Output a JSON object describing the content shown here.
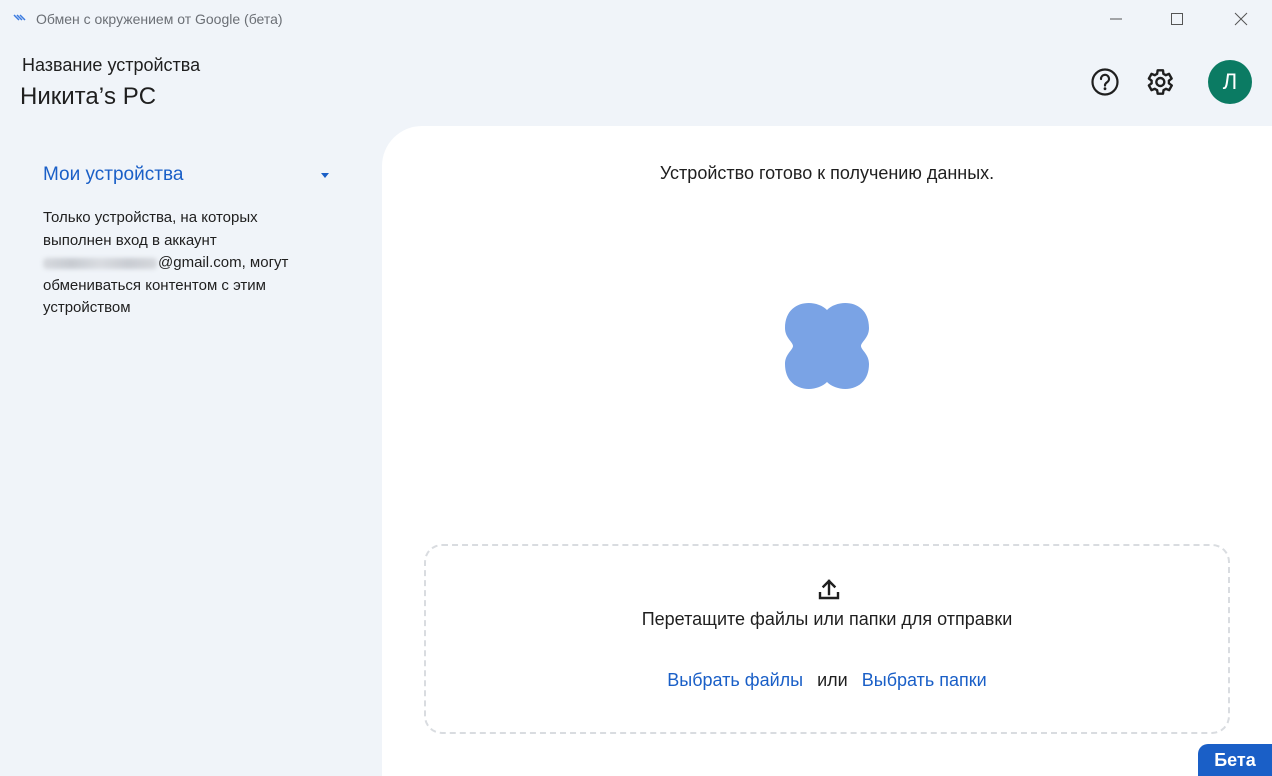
{
  "window": {
    "title": "Обмен с окружением от Google (бета)",
    "icon": "nearby-share-icon",
    "controls": [
      "minimize-icon",
      "maximize-icon",
      "close-icon"
    ]
  },
  "header": {
    "device_caption": "Название устройства",
    "device_name": "Никита’s PC",
    "icons": [
      "help-icon",
      "gear-icon"
    ],
    "avatar_letter": "Л",
    "avatar_color": "#0b7b63"
  },
  "sidebar": {
    "visibility_label": "Мои устройства",
    "description_line1": "Только устройства, на которых выполнен вход в аккаунт",
    "email_visible_suffix": "@gmail.com",
    "description_line2": ", могут обмениваться контентом с этим устройством"
  },
  "main": {
    "status": "Устройство готово к получению данных.",
    "dropzone": {
      "icon": "upload-icon",
      "text": "Перетащите файлы или папки для отправки",
      "choose_files": "Выбрать файлы",
      "or": "или",
      "choose_folders": "Выбрать папки"
    }
  },
  "badge": "Бета",
  "colors": {
    "accent": "#1a5fc7",
    "blob": "#7aa3e5",
    "background": "#f0f4f9",
    "panel": "#ffffff"
  }
}
